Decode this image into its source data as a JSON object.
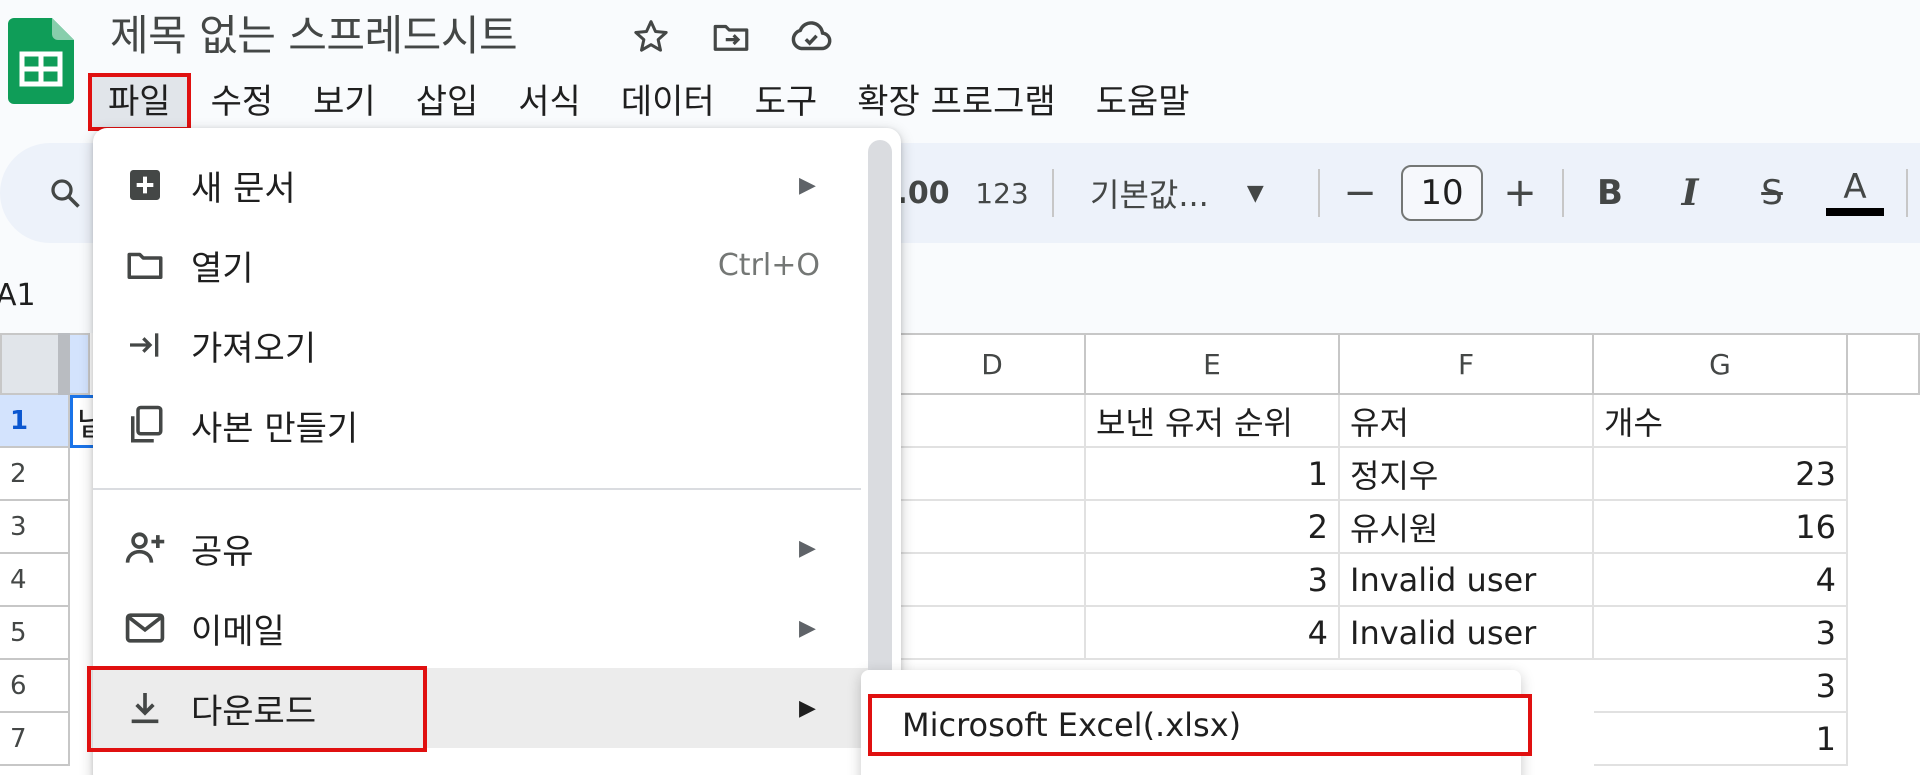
{
  "app": {
    "doc_title": "제목 없는 스프레드시트",
    "menu": [
      "파일",
      "수정",
      "보기",
      "삽입",
      "서식",
      "데이터",
      "도구",
      "확장 프로그램",
      "도움말"
    ],
    "active_menu": "파일"
  },
  "toolbar": {
    "decimal_label": ".00",
    "number_format_label": "123",
    "font_name": "기본값...",
    "font_size": "10",
    "minus_label": "−",
    "plus_label": "+",
    "bold_label": "B",
    "italic_label": "I",
    "strike_label": "S",
    "text_color_label": "A"
  },
  "name_box": "A1",
  "columns": [
    "D",
    "E",
    "F",
    "G"
  ],
  "rows": [
    {
      "num": "1",
      "e": "보낸 유저 순위",
      "f": "유저",
      "g": "개수"
    },
    {
      "num": "2",
      "e": "1",
      "f": "정지우",
      "g": "23"
    },
    {
      "num": "3",
      "e": "2",
      "f": "유시원",
      "g": "16"
    },
    {
      "num": "4",
      "e": "3",
      "f": "Invalid user",
      "g": "4"
    },
    {
      "num": "5",
      "e": "4",
      "f": "Invalid user",
      "g": "3"
    },
    {
      "num": "6",
      "e": "",
      "f": "",
      "g": "3"
    },
    {
      "num": "7",
      "e": "",
      "f": "",
      "g": "1"
    }
  ],
  "a1_partial": "닡",
  "file_menu": {
    "items": [
      {
        "label": "새 문서",
        "icon": "new-doc-icon",
        "has_submenu": true
      },
      {
        "label": "열기",
        "icon": "folder-icon",
        "shortcut": "Ctrl+O"
      },
      {
        "label": "가져오기",
        "icon": "import-icon"
      },
      {
        "label": "사본 만들기",
        "icon": "copy-icon"
      },
      {
        "label": "공유",
        "icon": "share-person-icon",
        "has_submenu": true
      },
      {
        "label": "이메일",
        "icon": "mail-icon",
        "has_submenu": true
      },
      {
        "label": "다운로드",
        "icon": "download-icon",
        "has_submenu": true,
        "highlighted": true
      }
    ],
    "submenu_arrow": "▶"
  },
  "download_submenu": {
    "items": [
      "Microsoft Excel(.xlsx)"
    ]
  },
  "colors": {
    "highlight_red": "#e01010",
    "sheets_green": "#0f9d58",
    "toolbar_bg": "#edf2fa"
  }
}
